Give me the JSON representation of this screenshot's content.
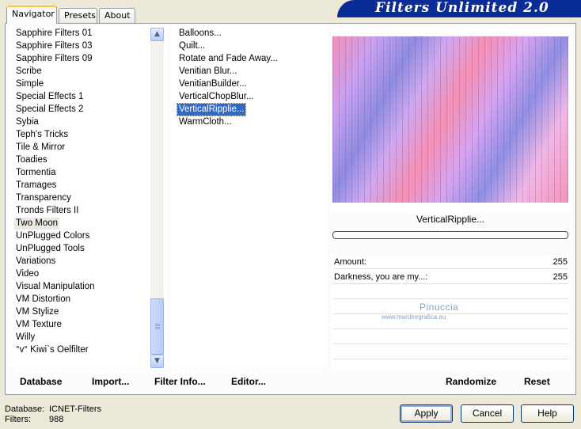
{
  "tabs": [
    {
      "label": "Navigator",
      "active": true
    },
    {
      "label": "Presets",
      "active": false
    },
    {
      "label": "About",
      "active": false
    }
  ],
  "brand_title": "Filters Unlimited 2.0",
  "categories": [
    "Sapphire Filters 01",
    "Sapphire Filters 03",
    "Sapphire Filters 09",
    "Scribe",
    "Simple",
    "Special Effects 1",
    "Special Effects 2",
    "Sybia",
    "Teph's Tricks",
    "Tile & Mirror",
    "Toadies",
    "Tormentia",
    "Tramages",
    "Transparency",
    "Tronds Filters II",
    "Two Moon",
    "UnPlugged Colors",
    "UnPlugged Tools",
    "Variations",
    "Video",
    "Visual Manipulation",
    "VM Distortion",
    "VM Stylize",
    "VM Texture",
    "Willy",
    "°v° Kiwi`s Oelfilter"
  ],
  "highlighted_category": "Two Moon",
  "filters": [
    "Balloons...",
    "Quilt...",
    "Rotate and Fade Away...",
    "Venitian Blur...",
    "VenitianBuilder...",
    "VerticalChopBlur...",
    "VerticalRipplie...",
    "WarmCloth..."
  ],
  "selected_filter": "VerticalRipplie...",
  "filter_name": "VerticalRipplie...",
  "parameters": [
    {
      "label": "Amount:",
      "value": "255"
    },
    {
      "label": "Darkness, you are my...:",
      "value": "255"
    }
  ],
  "watermark": {
    "name": "Pinuccia",
    "url": "www.mardiregrafica.eu"
  },
  "toolbar": {
    "database": "Database",
    "import": "Import...",
    "filter_info": "Filter Info...",
    "editor": "Editor...",
    "randomize": "Randomize",
    "reset": "Reset"
  },
  "info": {
    "database_label": "Database:",
    "database_value": "ICNET-Filters",
    "filters_label": "Filters:",
    "filters_value": "988"
  },
  "buttons": {
    "apply": "Apply",
    "cancel": "Cancel",
    "help": "Help"
  },
  "colors": {
    "brand": "#0a2c96",
    "selection": "#316ac5",
    "dialog": "#ece9d8"
  }
}
